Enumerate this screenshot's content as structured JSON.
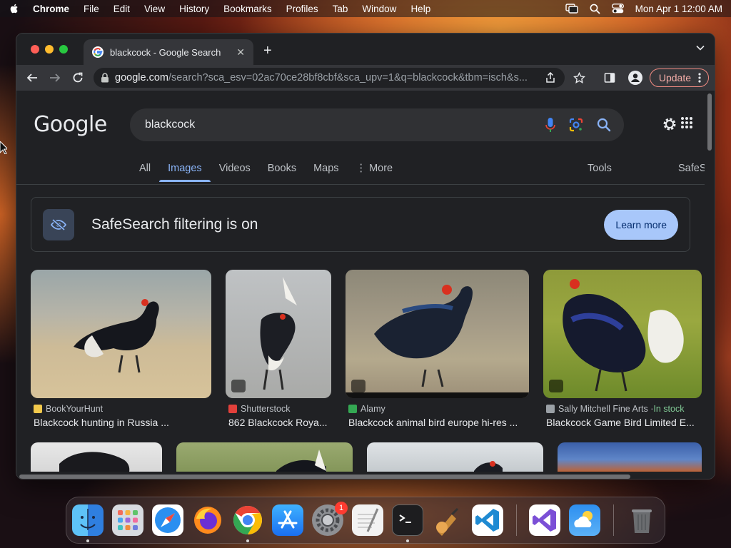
{
  "menubar": {
    "app": "Chrome",
    "items": [
      "File",
      "Edit",
      "View",
      "History",
      "Bookmarks",
      "Profiles",
      "Tab",
      "Window",
      "Help"
    ],
    "clock": "Mon Apr 1  12:00 AM"
  },
  "browser": {
    "tab_title": "blackcock - Google Search",
    "url_host": "google.com",
    "url_path": "/search?sca_esv=02ac70ce28bf8cbf&sca_upv=1&q=blackcock&tbm=isch&s...",
    "update_label": "Update"
  },
  "google": {
    "logo": "Google",
    "query": "blackcock",
    "tabs": [
      "All",
      "Images",
      "Videos",
      "Books",
      "Maps",
      "More"
    ],
    "active_tab": "Images",
    "tools_label": "Tools",
    "safesearch_label": "SafeS",
    "safesearch_message": "SafeSearch filtering is on",
    "learn_more": "Learn more"
  },
  "results": [
    {
      "source": "BookYourHunt",
      "title": "Blackcock hunting in Russia ...",
      "source_color": "#f2c94c"
    },
    {
      "source": "Shutterstock",
      "title": "862 Blackcock Roya...",
      "source_color": "#e2403b"
    },
    {
      "source": "Alamy",
      "title": "Blackcock animal bird europe hi-res ...",
      "source_color": "#34a853"
    },
    {
      "source": "Sally Mitchell Fine Arts · ",
      "stock": "In stock",
      "title": "Blackcock Game Bird Limited E...",
      "source_color": "#9aa0a6"
    }
  ],
  "dock": {
    "apps": [
      "Finder",
      "Launchpad",
      "Safari",
      "Firefox",
      "Chrome",
      "App Store",
      "System Settings",
      "TextEdit",
      "Terminal",
      "Instruments",
      "VS Code",
      "Visual Studio",
      "Weather",
      "Trash"
    ],
    "settings_badge": "1"
  },
  "colors": {
    "accent": "#8ab4f8",
    "page_bg": "#202124",
    "learn_more_bg": "#a8c7fa",
    "update_border": "#f28b82"
  }
}
